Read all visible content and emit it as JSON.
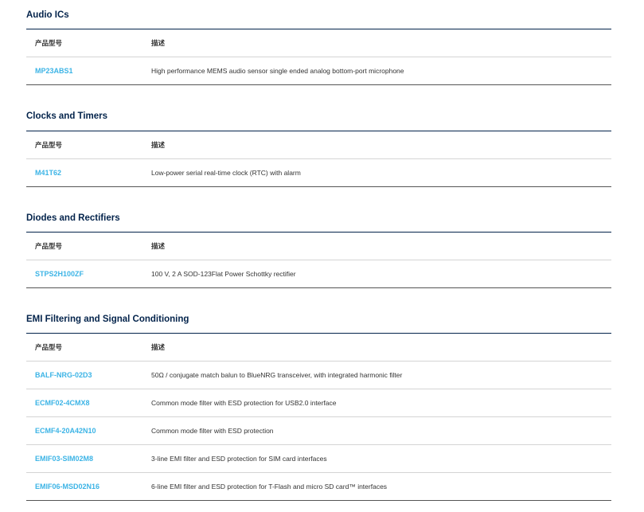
{
  "column_headers": {
    "part_number": "产品型号",
    "description": "描述"
  },
  "sections": [
    {
      "title": "Audio ICs",
      "rows": [
        {
          "part": "MP23ABS1",
          "desc": "High performance MEMS audio sensor single ended analog bottom-port microphone"
        }
      ]
    },
    {
      "title": "Clocks and Timers",
      "rows": [
        {
          "part": "M41T62",
          "desc": "Low-power serial real-time clock (RTC) with alarm"
        }
      ]
    },
    {
      "title": "Diodes and Rectifiers",
      "rows": [
        {
          "part": "STPS2H100ZF",
          "desc": "100 V, 2 A SOD-123Flat Power Schottky rectifier"
        }
      ]
    },
    {
      "title": "EMI Filtering and Signal Conditioning",
      "rows": [
        {
          "part": "BALF-NRG-02D3",
          "desc": "50Ω / conjugate match balun to BlueNRG transceiver, with integrated harmonic filter"
        },
        {
          "part": "ECMF02-4CMX8",
          "desc": "Common mode filter with ESD protection for USB2.0 interface"
        },
        {
          "part": "ECMF4-20A42N10",
          "desc": "Common mode filter with ESD protection"
        },
        {
          "part": "EMIF03-SIM02M8",
          "desc": "3-line EMI filter and ESD protection for SIM card interfaces"
        },
        {
          "part": "EMIF06-MSD02N16",
          "desc": "6-line EMI filter and ESD protection for T-Flash and micro SD card™ interfaces"
        }
      ]
    }
  ]
}
